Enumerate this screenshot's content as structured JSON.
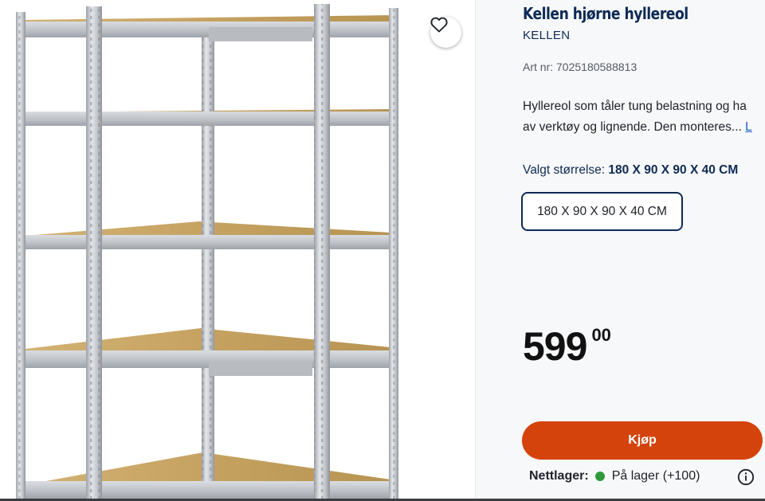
{
  "product": {
    "title": "Kellen hjørne hyllereol",
    "brand": "KELLEN",
    "article_number": "Art nr: 7025180588813",
    "description_line1": "Hyllereol som tåler tung belastning og ha",
    "description_line2": "av verktøy og lignende. Den monteres...",
    "description_more": "L",
    "selected_size_label": "Valgt størrelse:",
    "selected_size_value": "180 X 90 X 90 X 40 CM",
    "size_option": "180 X 90 X 90 X 40 CM",
    "price_int": "599",
    "price_dec": "00",
    "buy_label": "Kjøp",
    "stock_label": "Nettlager:",
    "stock_status": "På lager (+100)"
  },
  "colors": {
    "title": "#0e2a55",
    "buy_button": "#d4430b",
    "stock_dot": "#2f9a3a",
    "shelf_board": "#c9a567",
    "frame": "#c2c6cc"
  },
  "icons": {
    "favorite": "heart-outline-icon",
    "info": "info-circle-icon"
  }
}
